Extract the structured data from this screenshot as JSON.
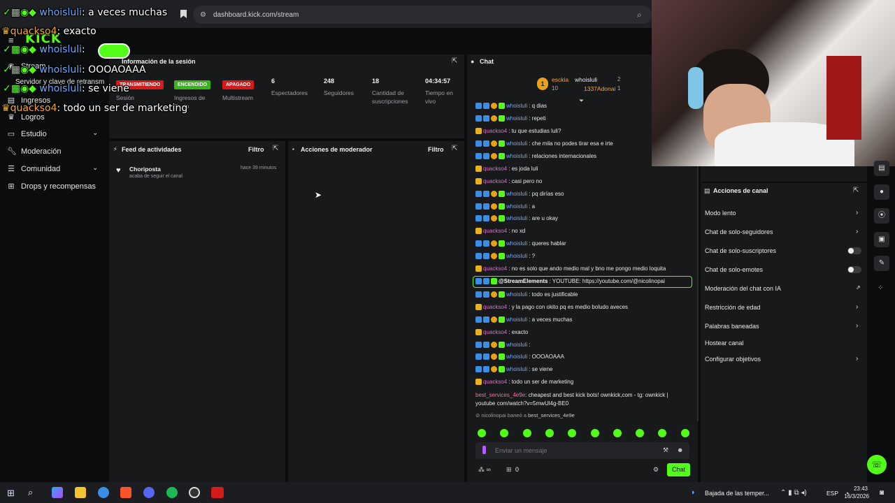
{
  "browser": {
    "url": "dashboard.kick.com/stream"
  },
  "overlay_chat": [
    {
      "user": "whoisluli",
      "text": ": a veces muchas",
      "color": "blue"
    },
    {
      "user": "quackso4",
      "text": ": exacto",
      "color": "orange"
    },
    {
      "user": "whoisluli",
      "text": ":",
      "color": "blue"
    },
    {
      "user": "whoisluli",
      "text": ": OOOAOAAA",
      "color": "blue"
    },
    {
      "user": "whoisluli",
      "text": ": se viene",
      "color": "blue"
    },
    {
      "user": "quackso4",
      "text": ": todo un ser de marketing",
      "color": "orange"
    }
  ],
  "app": {
    "logo": "KICK"
  },
  "sidebar": {
    "items": [
      {
        "label": "Stream",
        "icon": "stream-icon"
      },
      {
        "label": "Servidor y clave de retransm",
        "icon": "server-icon"
      },
      {
        "label": "Ingresos",
        "icon": "money-icon"
      },
      {
        "label": "Logros",
        "icon": "trophy-icon"
      },
      {
        "label": "Estudio",
        "icon": "studio-icon"
      },
      {
        "label": "Moderación",
        "icon": "wrench-icon"
      },
      {
        "label": "Comunidad",
        "icon": "people-icon"
      },
      {
        "label": "Drops y recompensas",
        "icon": "gift-icon"
      }
    ]
  },
  "session": {
    "title": "Información de la sesión",
    "stats": [
      {
        "badge": "TRANSMITIENDO",
        "label": "Sesión",
        "color": "#d61a1a"
      },
      {
        "badge": "ENCENDIDO",
        "label": "Ingresos de Socio",
        "color": "#3bb31a"
      },
      {
        "badge": "APAGADO",
        "label": "Multistream",
        "color": "#d61a1a"
      },
      {
        "value": "6",
        "label": "Espectadores"
      },
      {
        "value": "248",
        "label": "Seguidores"
      },
      {
        "value": "18",
        "label": "Cantidad de suscripciones"
      },
      {
        "value": "04:34:57",
        "label": "Tiempo en vivo"
      }
    ]
  },
  "feed": {
    "title": "Feed de actividades",
    "filter": "Filtro",
    "items": [
      {
        "name": "Choriposta",
        "sub": "acaba de seguir el canal",
        "time": "hace 39 minutos"
      }
    ]
  },
  "mod": {
    "title": "Acciones de moderador",
    "filter": "Filtro"
  },
  "chat": {
    "title": "Chat",
    "leaderboard": [
      {
        "rank": "1",
        "name": "esckia",
        "pts": "10"
      },
      {
        "name": "whoisluli",
        "pts": "2"
      },
      {
        "name": "1337Adonai",
        "pts": "1"
      }
    ],
    "messages": [
      {
        "user": "whoisluli",
        "text": ": q dias",
        "color": "blue"
      },
      {
        "user": "whoisluli",
        "text": ": repeti",
        "color": "blue"
      },
      {
        "user": "quackso4",
        "text": ": tu que estudias luli?",
        "color": "orange"
      },
      {
        "user": "whoisluli",
        "text": ": che mila no podes tirar esa e irte",
        "color": "blue"
      },
      {
        "user": "whoisluli",
        "text": ": relaciones internacionales",
        "color": "blue"
      },
      {
        "user": "quackso4",
        "text": ": es joda luli",
        "color": "orange"
      },
      {
        "user": "quackso4",
        "text": ": casi pero no",
        "color": "orange"
      },
      {
        "user": "whoisluli",
        "text": ": pq dirías eso",
        "color": "blue"
      },
      {
        "user": "whoisluli",
        "text": ": a",
        "color": "blue"
      },
      {
        "user": "whoisluli",
        "text": ": are u okay",
        "color": "blue"
      },
      {
        "user": "quackso4",
        "text": ": no xd",
        "color": "orange"
      },
      {
        "user": "whoisluli",
        "text": ": queres hablar",
        "color": "blue"
      },
      {
        "user": "whoisluli",
        "text": ": ?",
        "color": "blue"
      },
      {
        "user": "quackso4",
        "text": ": no es solo que ando medio mal y bno me pongo medio loquita",
        "color": "orange"
      },
      {
        "user": "@StreamElements",
        "text": ": YOUTUBE: https://youtube.com/@nicolinopai",
        "color": "green"
      },
      {
        "user": "whoisluli",
        "text": ": todo es justificable",
        "color": "blue"
      },
      {
        "user": "quackso4",
        "text": ": y la pago con okito pq es medio boludo aveces",
        "color": "orange"
      },
      {
        "user": "whoisluli",
        "text": ": a veces muchas",
        "color": "blue"
      },
      {
        "user": "quackso4",
        "text": ": exacto",
        "color": "orange"
      },
      {
        "user": "whoisluli",
        "text": ":",
        "color": "blue"
      },
      {
        "user": "whoisluli",
        "text": ": OOOAOAAA",
        "color": "blue"
      },
      {
        "user": "whoisluli",
        "text": ": se viene",
        "color": "blue"
      },
      {
        "user": "quackso4",
        "text": ": todo un ser de marketing",
        "color": "orange"
      }
    ],
    "spam": {
      "user": "best_services_4e9e",
      "text": ": cheapest and best kick bots! ownkick,com - tg: ownkick | youtube com/watch?v=5mwUl4g-BE0"
    },
    "ban": {
      "mod": "nicolinopai",
      "action": "baneó a",
      "target": "best_services_4e9e"
    },
    "input_placeholder": "Enviar un mensaje",
    "send_label": "Chat",
    "points": "0"
  },
  "channel_actions": {
    "title": "Acciones de canal",
    "items": [
      {
        "label": "Modo lento",
        "kind": "chevron"
      },
      {
        "label": "Chat de solo-seguidores",
        "kind": "chevron"
      },
      {
        "label": "Chat de solo-suscriptores",
        "kind": "toggle"
      },
      {
        "label": "Chat de solo-emotes",
        "kind": "toggle"
      },
      {
        "label": "Moderación del chat con IA",
        "kind": "link"
      },
      {
        "label": "Restricción de edad",
        "kind": "chevron"
      },
      {
        "label": "Palabras baneadas",
        "kind": "chevron"
      },
      {
        "label": "Hostear canal",
        "kind": "none"
      },
      {
        "label": "Configurar objetivos",
        "kind": "chevron"
      }
    ]
  },
  "taskbar": {
    "weather": "Bajada de las temper...",
    "lang": "ESP",
    "time": "23:43",
    "date": "16/3/2026"
  }
}
